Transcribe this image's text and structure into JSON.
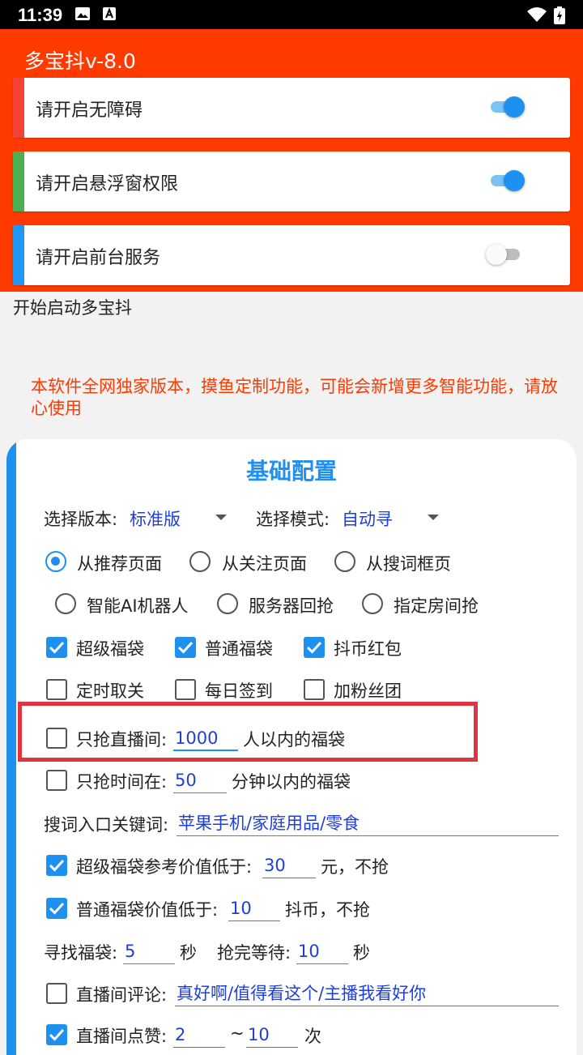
{
  "status": {
    "time": "11:39"
  },
  "app": {
    "title": "多宝抖v-8.0"
  },
  "permissions": [
    {
      "label": "请开启无障碍",
      "enabled": true,
      "color": "#f44336"
    },
    {
      "label": "请开启悬浮窗权限",
      "enabled": true,
      "color": "#4caf50"
    },
    {
      "label": "请开启前台服务",
      "enabled": false,
      "color": "#2196f3"
    }
  ],
  "start_text": "开始启动多宝抖",
  "notice": "本软件全网独家版本，摸鱼定制功能，可能会新增更多智能功能，请放心使用",
  "config": {
    "title": "基础配置",
    "version_label": "选择版本:",
    "version_value": "标准版",
    "mode_label": "选择模式:",
    "mode_value": "自动寻",
    "radio_row1": [
      {
        "label": "从推荐页面",
        "selected": true
      },
      {
        "label": "从关注页面",
        "selected": false
      },
      {
        "label": "从搜词框页",
        "selected": false
      }
    ],
    "radio_row2": [
      {
        "label": "智能AI机器人",
        "selected": false
      },
      {
        "label": "服务器回抢",
        "selected": false
      },
      {
        "label": "指定房间抢",
        "selected": false
      }
    ],
    "check_row1": [
      {
        "label": "超级福袋",
        "checked": true
      },
      {
        "label": "普通福袋",
        "checked": true
      },
      {
        "label": "抖币红包",
        "checked": true
      }
    ],
    "check_row2": [
      {
        "label": "定时取关",
        "checked": false
      },
      {
        "label": "每日签到",
        "checked": false
      },
      {
        "label": "加粉丝团",
        "checked": false
      }
    ],
    "live_limit": {
      "label": "只抢直播间:",
      "value": "1000",
      "suffix": "人以内的福袋",
      "checked": false
    },
    "time_limit": {
      "label": "只抢时间在:",
      "value": "50",
      "suffix": "分钟以内的福袋",
      "checked": false
    },
    "keyword": {
      "label": "搜词入口关键词:",
      "value": "苹果手机/家庭用品/零食"
    },
    "super_min": {
      "label": "超级福袋参考价值低于:",
      "value": "30",
      "suffix": "元，不抢",
      "checked": true
    },
    "normal_min": {
      "label": "普通福袋价值低于:",
      "value": "10",
      "suffix": "抖币，不抢",
      "checked": true
    },
    "find": {
      "label": "寻找福袋:",
      "value": "5",
      "unit": "秒",
      "wait_label": "抢完等待:",
      "wait_value": "10",
      "wait_unit": "秒"
    },
    "comment": {
      "label": "直播间评论:",
      "value": "真好啊/值得看这个/主播我看好你",
      "checked": false
    },
    "like": {
      "label": "直播间点赞:",
      "from": "2",
      "sep": "~",
      "to": "10",
      "unit": "次",
      "checked": true
    }
  }
}
